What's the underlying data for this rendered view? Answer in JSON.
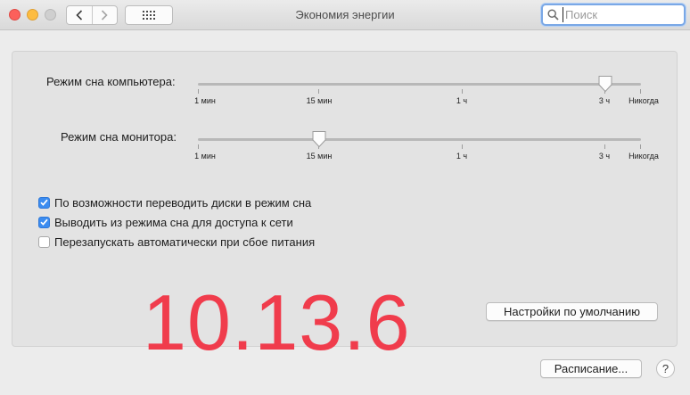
{
  "window": {
    "title": "Экономия энергии"
  },
  "toolbar": {
    "back_icon": "chevron-left-icon",
    "forward_icon": "chevron-right-icon",
    "grid_icon": "grid-icon"
  },
  "search": {
    "placeholder": "Поиск",
    "value": ""
  },
  "sliders": {
    "computer": {
      "label": "Режим сна компьютера:",
      "selected": "3 ч",
      "ticks": [
        "1 мин",
        "15 мин",
        "1 ч",
        "3 ч",
        "Никогда"
      ]
    },
    "display": {
      "label": "Режим сна монитора:",
      "selected": "15 мин",
      "ticks": [
        "1 мин",
        "15 мин",
        "1 ч",
        "3 ч",
        "Никогда"
      ]
    }
  },
  "checkboxes": [
    {
      "label": "По возможности переводить диски в режим сна",
      "checked": true
    },
    {
      "label": "Выводить из режима сна для доступа к сети",
      "checked": true
    },
    {
      "label": "Перезапускать автоматически при сбое питания",
      "checked": false
    }
  ],
  "overlay": {
    "version": "10.13.6",
    "color": "#f03c4c"
  },
  "buttons": {
    "defaults": "Настройки по умолчанию",
    "schedule": "Расписание...",
    "help": "?"
  },
  "colors": {
    "accent": "#3b8cf0",
    "close": "#fc605b",
    "minimize": "#fdbc40"
  }
}
